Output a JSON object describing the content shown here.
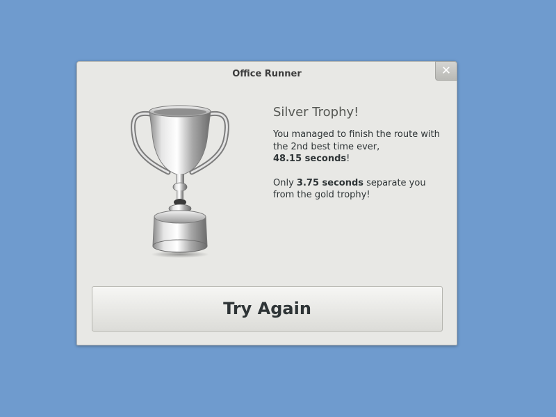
{
  "window": {
    "title": "Office Runner",
    "close_symbol": "✕"
  },
  "trophy": {
    "icon": "silver-trophy-icon",
    "color": "#c8c8c8"
  },
  "message": {
    "title": "Silver Trophy!",
    "line1": "You managed to finish the route with",
    "line2": "the 2nd best time ever,",
    "time": "48.15 seconds",
    "time_suffix": "!",
    "gap_prefix": "Only ",
    "gap": "3.75 seconds",
    "gap_suffix": " separate you",
    "gap_line2": "from the gold trophy!"
  },
  "buttons": {
    "try_again": "Try Again"
  },
  "colors": {
    "desktop": "#6f9bce",
    "dialog": "#e8e8e5"
  }
}
